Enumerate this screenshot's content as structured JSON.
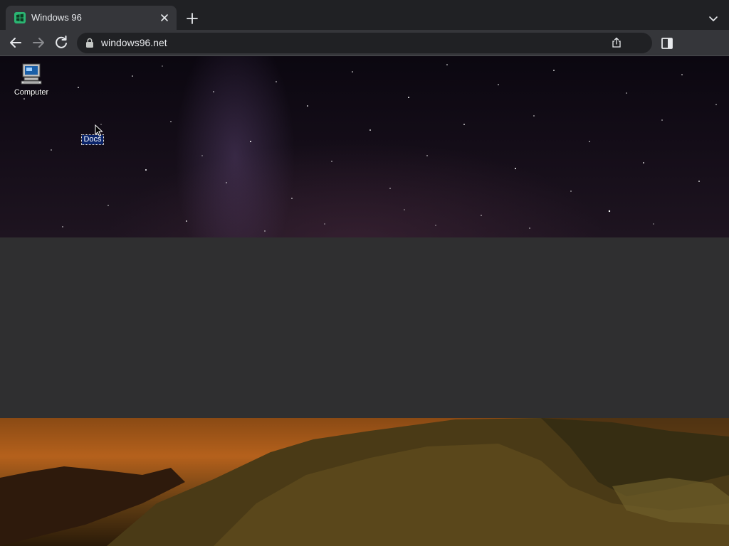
{
  "browser": {
    "tab": {
      "title": "Windows 96",
      "favicon": "windows96-logo-icon"
    },
    "address_bar": {
      "url": "windows96.net"
    },
    "icons": [
      "back-icon",
      "forward-icon",
      "reload-icon",
      "lock-icon",
      "share-icon",
      "side-panel-icon",
      "close-icon",
      "plus-icon",
      "chevron-down-icon"
    ]
  },
  "desktop": {
    "icons": [
      {
        "label": "Computer",
        "icon": "computer-icon",
        "selected": false
      },
      {
        "label": "Docs",
        "icon": "folder-icon",
        "selected": true
      }
    ]
  },
  "colors": {
    "browser_frame": "#202124",
    "toolbar": "#35363a",
    "selection": "#0a246a",
    "favicon": "#2bb673"
  }
}
